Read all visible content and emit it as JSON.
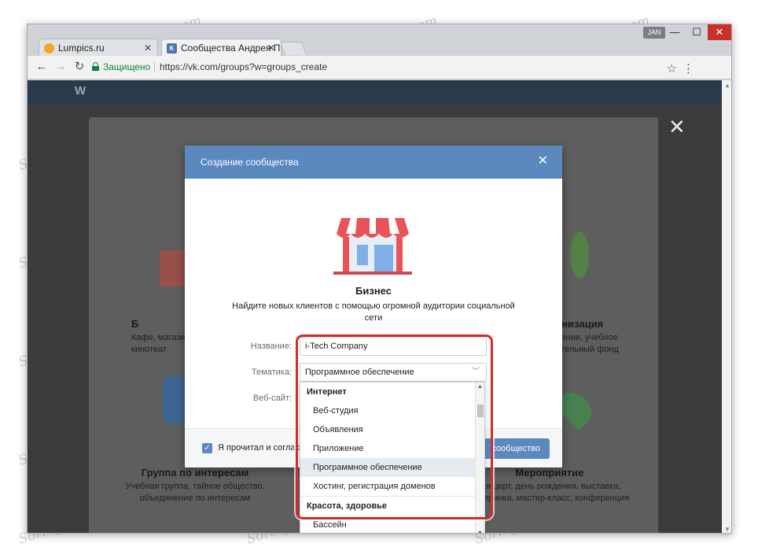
{
  "browser": {
    "tabs": [
      {
        "label": "Lumpics.ru",
        "active": false,
        "favicon": "orange-circle"
      },
      {
        "label": "Сообщества Андрея Пе",
        "active": true,
        "favicon": "vk-logo"
      }
    ],
    "tab_close": "✕",
    "user_badge": "JAN",
    "window_buttons": {
      "minimize": "—",
      "maximize": "☐",
      "close": "✕"
    },
    "secure_label": "Защищено",
    "url": "https://vk.com/groups?w=groups_create",
    "colors": {
      "secure": "#0b8043",
      "close_button": "#c9302c"
    }
  },
  "page": {
    "logo": "W",
    "background_cards": [
      {
        "title": "Группа по интересам",
        "desc_lines": [
          "Учебная группа, тайное общество,",
          "объединение по интересам"
        ]
      },
      {
        "title": "Мероприятие",
        "desc_lines": [
          "Концерт, день рождения, выставка,",
          "вечеринка, мастер-класс, конференция"
        ]
      }
    ],
    "partial_left": {
      "title": "Б",
      "desc_lines": [
        "Кафе, магазин",
        "кинотеат"
      ]
    },
    "partial_right": {
      "title": "анизация",
      "desc_lines": [
        "ление, учебное",
        "ительный фонд"
      ]
    },
    "outer_close": "✕"
  },
  "modal": {
    "title": "Создание сообщества",
    "close": "✕",
    "business_title": "Бизнес",
    "business_desc": "Найдите новых клиентов с помощью огромной аудитории социальной сети",
    "form": {
      "name_label": "Название:",
      "name_value": "i-Tech Company",
      "theme_label": "Тематика:",
      "theme_value": "Программное обеспечение",
      "site_label": "Веб-сайт:"
    },
    "agree_text": "Я прочитал и соглас",
    "create_button": "сообщество",
    "accent": "#5b88bd"
  },
  "dropdown": {
    "groups": [
      {
        "name": "Интернет",
        "items": [
          "Веб-студия",
          "Объявления",
          "Приложение",
          "Программное обеспечение",
          "Хостинг, регистрация доменов"
        ]
      },
      {
        "name": "Красота, здоровье",
        "items": [
          "Бассейн"
        ]
      }
    ],
    "hovered": "Программное обеспечение",
    "highlight_color": "#d32b2b"
  },
  "watermark": "Soringpcrepair.com"
}
